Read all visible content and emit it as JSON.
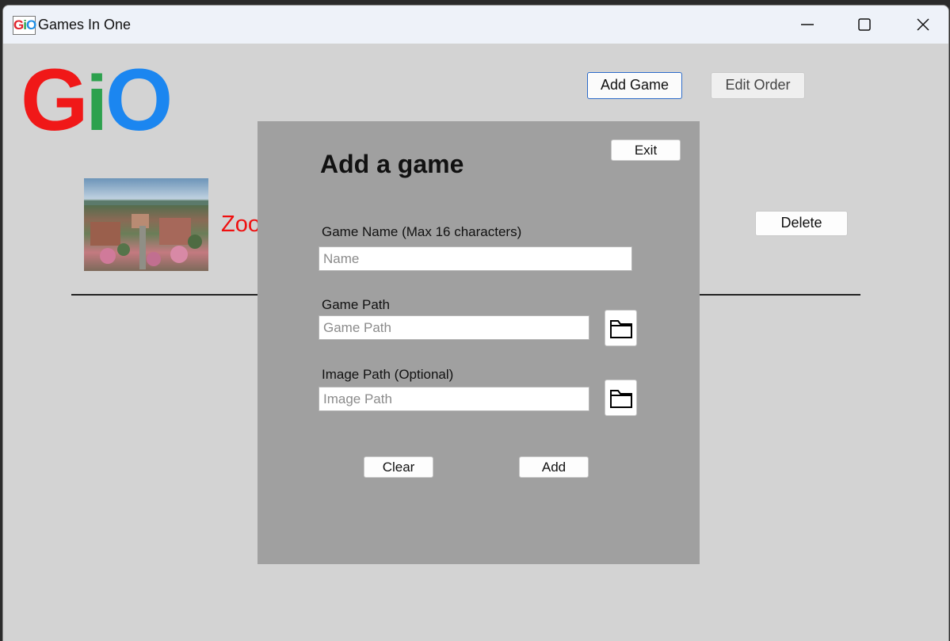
{
  "window": {
    "title": "Games In One",
    "icon_letters": {
      "g": "G",
      "i": "i",
      "o": "O"
    }
  },
  "logo": {
    "g": "G",
    "i": "i",
    "o": "O",
    "colors": {
      "g": "#f01818",
      "i": "#2da14d",
      "o": "#1b86f0"
    }
  },
  "toolbar": {
    "add_game_label": "Add Game",
    "edit_order_label": "Edit Order"
  },
  "games": [
    {
      "name": "Zoo",
      "delete_label": "Delete"
    }
  ],
  "dialog": {
    "title": "Add a game",
    "exit_label": "Exit",
    "name_label": "Game Name (Max 16 characters)",
    "name_placeholder": "Name",
    "path_label": "Game Path",
    "path_placeholder": "Game Path",
    "image_label": "Image Path (Optional)",
    "image_placeholder": "Image Path",
    "clear_label": "Clear",
    "add_label": "Add"
  },
  "icons": {
    "minimize": "minimize-icon",
    "maximize": "maximize-icon",
    "close": "close-icon",
    "folder": "folder-icon"
  }
}
